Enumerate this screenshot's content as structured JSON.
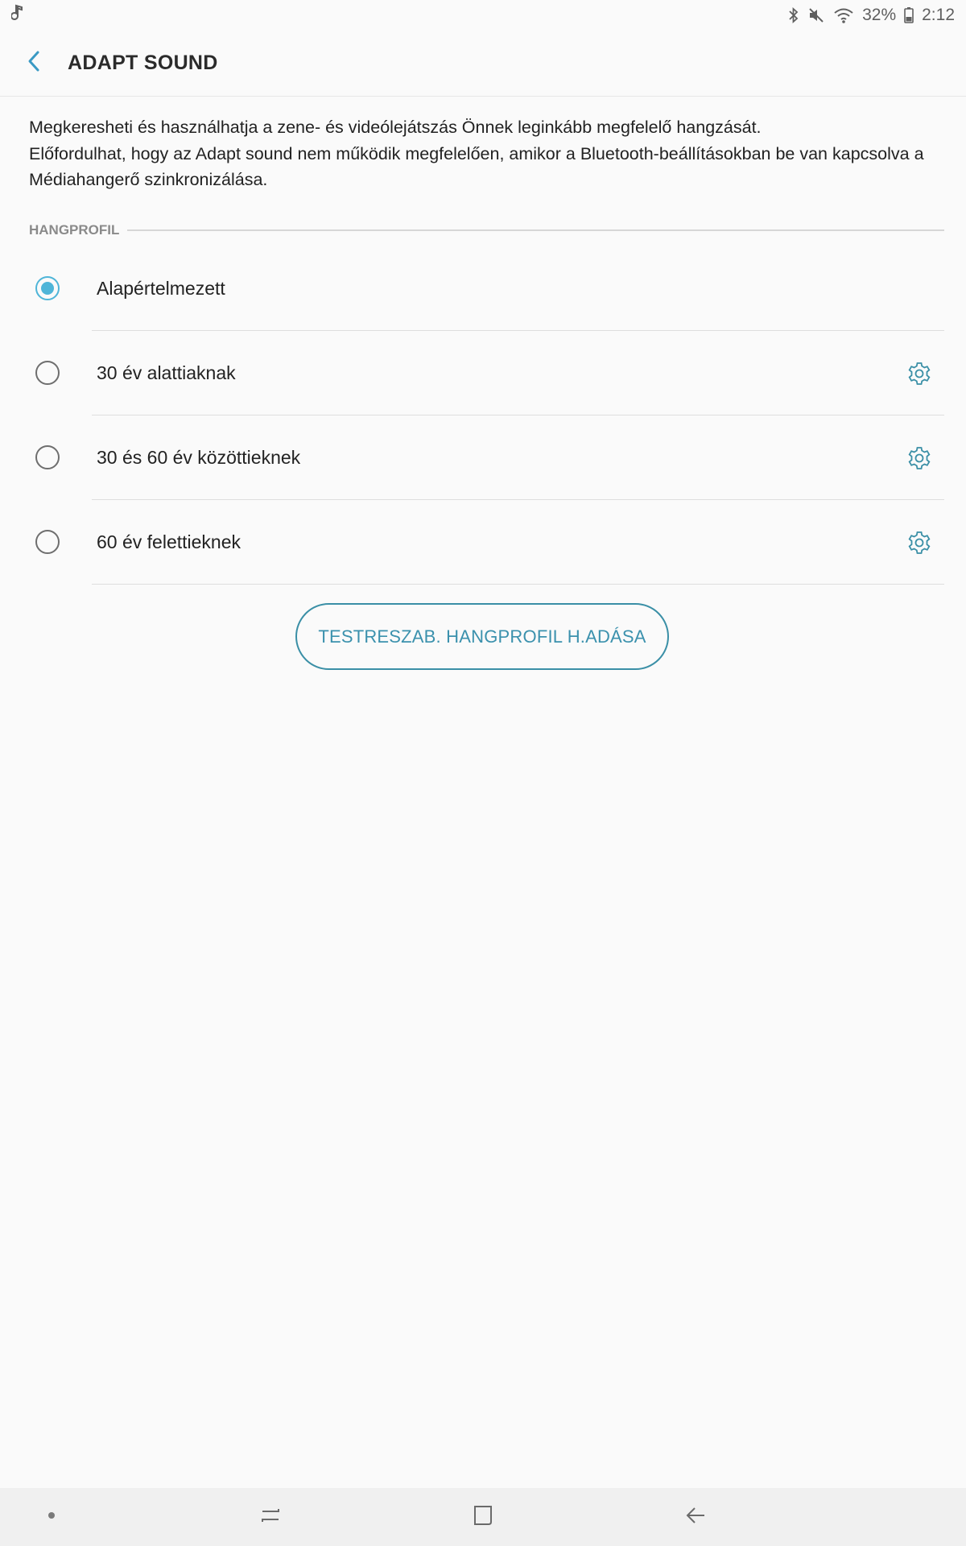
{
  "status_bar": {
    "battery": "32%",
    "time": "2:12",
    "icons": [
      "music-note-icon",
      "bluetooth-icon",
      "mute-icon",
      "wifi-icon",
      "battery-icon"
    ]
  },
  "app_bar": {
    "title": "ADAPT SOUND"
  },
  "description": {
    "line1": "Megkeresheti és használhatja a zene- és videólejátszás Önnek leginkább megfelelő hangzását.",
    "line2": "Előfordulhat, hogy az Adapt sound nem működik megfelelően, amikor a Bluetooth-beállításokban be van kapcsolva a Médiahangerő szinkronizálása."
  },
  "section": {
    "label": "HANGPROFIL"
  },
  "options": [
    {
      "label": "Alapértelmezett",
      "selected": true,
      "has_settings": false
    },
    {
      "label": "30 év alattiaknak",
      "selected": false,
      "has_settings": true
    },
    {
      "label": "30 és 60 év közöttieknek",
      "selected": false,
      "has_settings": true
    },
    {
      "label": "60 év felettieknek",
      "selected": false,
      "has_settings": true
    }
  ],
  "add_button": {
    "label": "TESTRESZAB. HANGPROFIL H.ADÁSA"
  },
  "nav_bar": {
    "icons": [
      "dot-icon",
      "recents-icon",
      "home-icon",
      "back-icon"
    ]
  },
  "colors": {
    "accent": "#4fb5d8",
    "button_text": "#3b91ad",
    "background": "#fafafa"
  }
}
